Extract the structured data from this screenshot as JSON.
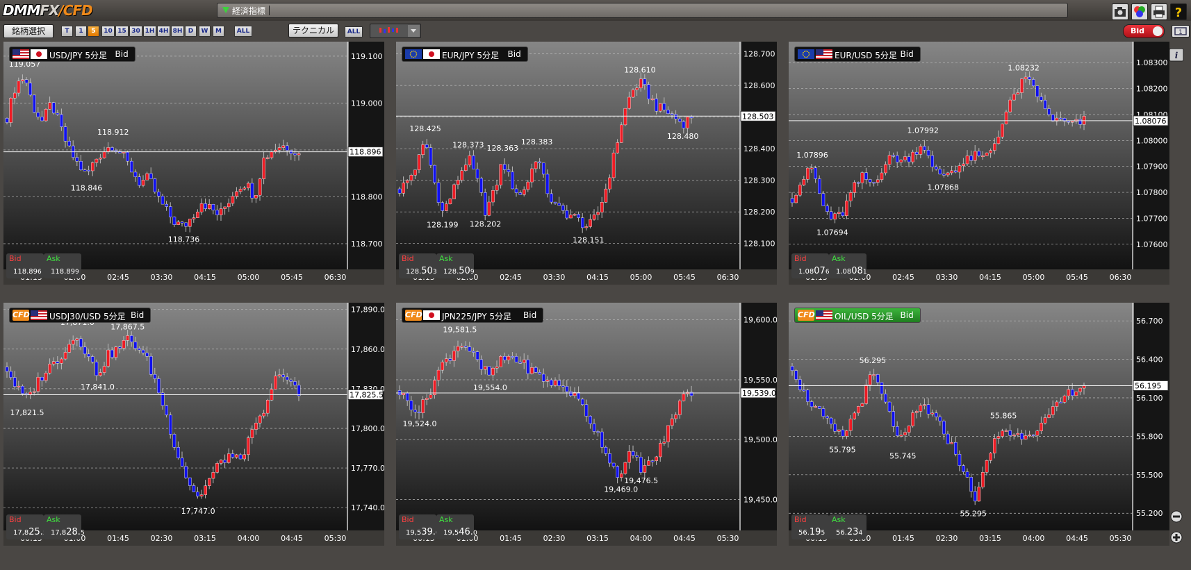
{
  "app": {
    "logo_dmm": "DMM",
    "logo_fx": "FX",
    "logo_slash": "/",
    "logo_cfd": "CFD"
  },
  "news": {
    "label": "経済指標"
  },
  "toolbar": {
    "symbol_select": "銘柄選択",
    "timeframes": [
      "T",
      "1",
      "5",
      "10",
      "15",
      "30",
      "1H",
      "4H",
      "8H",
      "D",
      "W",
      "M"
    ],
    "active_timeframe": "5",
    "tf_all": "ALL",
    "technical": "テクニカル",
    "tech_all": "ALL",
    "bid_toggle": "Bid"
  },
  "colors": {
    "up": "#ee1c25",
    "down": "#1010ee",
    "doji": "#d8d000",
    "accent": "#f08a1a"
  },
  "panels": [
    {
      "title": "USD/JPY 5分足",
      "mode": "Bid",
      "flags": [
        "us",
        "jp"
      ],
      "cfd": false,
      "current": "118.896",
      "current_value": 118.896,
      "bid": {
        "label": "Bid",
        "small": "118.89",
        "big": "",
        "tail": "6"
      },
      "ask": {
        "label": "Ask",
        "small": "118.89",
        "big": "",
        "tail": "9"
      },
      "ymin": 118.66,
      "ymax": 119.125,
      "ticks": [
        119.1,
        119.0,
        118.9,
        118.8,
        118.7
      ],
      "tick_labels": [
        "119.100",
        "119.000",
        "118.900",
        "118.800",
        "118.700"
      ],
      "xlabels": [
        "01:15",
        "02:00",
        "02:45",
        "03:30",
        "04:15",
        "05:00",
        "05:45",
        "06:30"
      ],
      "path": [
        118.97,
        119.04,
        119.057,
        118.99,
        118.96,
        119.0,
        118.95,
        118.9,
        118.87,
        118.846,
        118.88,
        118.9,
        118.912,
        118.89,
        118.86,
        118.83,
        118.84,
        118.8,
        118.77,
        118.745,
        118.736,
        118.76,
        118.79,
        118.775,
        118.76,
        118.79,
        118.82,
        118.83,
        118.8,
        118.88,
        118.9,
        118.91,
        118.905,
        118.89
      ],
      "annotations": [
        {
          "i": 2,
          "v": 119.057,
          "text": "119.057",
          "pos": "above"
        },
        {
          "i": 9,
          "v": 118.846,
          "text": "118.846",
          "pos": "below"
        },
        {
          "i": 12,
          "v": 118.912,
          "text": "118.912",
          "pos": "above"
        },
        {
          "i": 20,
          "v": 118.736,
          "text": "118.736",
          "pos": "below"
        }
      ]
    },
    {
      "title": "EUR/JPY 5分足",
      "mode": "Bid",
      "flags": [
        "eu",
        "jp"
      ],
      "cfd": false,
      "current": "128.503",
      "current_value": 128.503,
      "bid": {
        "label": "Bid",
        "small": "128.",
        "big": "50",
        "tail": "3"
      },
      "ask": {
        "label": "Ask",
        "small": "128.",
        "big": "50",
        "tail": "9"
      },
      "ymin": 128.04,
      "ymax": 128.73,
      "ticks": [
        128.7,
        128.6,
        128.5,
        128.4,
        128.3,
        128.2,
        128.1
      ],
      "tick_labels": [
        "128.700",
        "128.600",
        "128.500",
        "128.400",
        "128.300",
        "128.200",
        "128.100"
      ],
      "xlabels": [
        "01:15",
        "02:00",
        "02:45",
        "03:30",
        "04:15",
        "05:00",
        "05:45",
        "06:30"
      ],
      "path": [
        128.27,
        128.3,
        128.35,
        128.425,
        128.3,
        128.199,
        128.25,
        128.32,
        128.373,
        128.3,
        128.202,
        128.26,
        128.363,
        128.29,
        128.25,
        128.3,
        128.383,
        128.28,
        128.22,
        128.2,
        128.19,
        128.17,
        128.151,
        128.19,
        128.27,
        128.38,
        128.5,
        128.58,
        128.61,
        128.57,
        128.53,
        128.52,
        128.5,
        128.48,
        128.503
      ],
      "annotations": [
        {
          "i": 3,
          "v": 128.425,
          "text": "128.425",
          "pos": "above"
        },
        {
          "i": 5,
          "v": 128.199,
          "text": "128.199",
          "pos": "below"
        },
        {
          "i": 8,
          "v": 128.373,
          "text": "128.373",
          "pos": "above"
        },
        {
          "i": 10,
          "v": 128.202,
          "text": "128.202",
          "pos": "below"
        },
        {
          "i": 12,
          "v": 128.363,
          "text": "128.363",
          "pos": "above"
        },
        {
          "i": 16,
          "v": 128.383,
          "text": "128.383",
          "pos": "above"
        },
        {
          "i": 22,
          "v": 128.151,
          "text": "128.151",
          "pos": "below"
        },
        {
          "i": 28,
          "v": 128.61,
          "text": "128.610",
          "pos": "above"
        },
        {
          "i": 33,
          "v": 128.48,
          "text": "128.480",
          "pos": "below"
        }
      ]
    },
    {
      "title": "EUR/USD 5分足",
      "mode": "Bid",
      "flags": [
        "eu",
        "us"
      ],
      "cfd": false,
      "current": "1.08076",
      "current_value": 1.08076,
      "bid": {
        "label": "Bid",
        "small": "1.08",
        "big": "07",
        "tail": "6"
      },
      "ask": {
        "label": "Ask",
        "small": "1.08",
        "big": "08",
        "tail": "1"
      },
      "ymin": 1.0753,
      "ymax": 1.0837,
      "ticks": [
        1.083,
        1.082,
        1.081,
        1.08,
        1.079,
        1.078,
        1.077,
        1.076
      ],
      "tick_labels": [
        "1.08300",
        "1.08200",
        "1.08100",
        "1.08000",
        "1.07900",
        "1.07800",
        "1.07700",
        "1.07600"
      ],
      "xlabels": [
        "01:15",
        "02:00",
        "02:45",
        "03:30",
        "04:15",
        "05:00",
        "05:45",
        "06:30"
      ],
      "path": [
        1.0778,
        1.0785,
        1.07896,
        1.0775,
        1.07694,
        1.0772,
        1.0781,
        1.0786,
        1.0783,
        1.079,
        1.0794,
        1.0792,
        1.0795,
        1.07992,
        1.0788,
        1.07868,
        1.0789,
        1.0791,
        1.0794,
        1.0793,
        1.0798,
        1.0808,
        1.0817,
        1.08232,
        1.0821,
        1.0812,
        1.0808,
        1.0807,
        1.0806,
        1.08076
      ],
      "annotations": [
        {
          "i": 2,
          "v": 1.07896,
          "text": "1.07896",
          "pos": "above"
        },
        {
          "i": 4,
          "v": 1.07694,
          "text": "1.07694",
          "pos": "below"
        },
        {
          "i": 13,
          "v": 1.07992,
          "text": "1.07992",
          "pos": "above"
        },
        {
          "i": 15,
          "v": 1.07868,
          "text": "1.07868",
          "pos": "below"
        },
        {
          "i": 23,
          "v": 1.08232,
          "text": "1.08232",
          "pos": "above"
        }
      ]
    },
    {
      "title": "USDJ30/USD 5分足",
      "mode": "Bid",
      "flags": [
        "us"
      ],
      "cfd": true,
      "current": "17,825.5",
      "current_value": 17825.5,
      "bid": {
        "label": "Bid",
        "small": "17,8",
        "big": "25.",
        "tail": "5"
      },
      "ask": {
        "label": "Ask",
        "small": "17,8",
        "big": "28.",
        "tail": "5"
      },
      "ymin": 17728,
      "ymax": 17893,
      "ticks": [
        17890,
        17860,
        17830,
        17800,
        17770,
        17740
      ],
      "tick_labels": [
        "17,890.0",
        "17,860.0",
        "17,830.0",
        "17,800.0",
        "17,770.0",
        "17,740.0"
      ],
      "xlabels": [
        "00:15",
        "01:00",
        "01:45",
        "02:30",
        "03:15",
        "04:00",
        "04:45",
        "05:30"
      ],
      "path": [
        17845,
        17830,
        17821.5,
        17835,
        17845,
        17852,
        17862,
        17871,
        17855,
        17841,
        17855,
        17860,
        17867.5,
        17862,
        17850,
        17830,
        17805,
        17780,
        17760,
        17747,
        17760,
        17772,
        17780,
        17775,
        17790,
        17805,
        17820,
        17845,
        17835,
        17825.5
      ],
      "annotations": [
        {
          "i": 2,
          "v": 17821.5,
          "text": "17,821.5",
          "pos": "below"
        },
        {
          "i": 7,
          "v": 17871,
          "text": "17,871.0",
          "pos": "above"
        },
        {
          "i": 9,
          "v": 17841,
          "text": "17,841.0",
          "pos": "below"
        },
        {
          "i": 12,
          "v": 17867.5,
          "text": "17,867.5",
          "pos": "above"
        },
        {
          "i": 19,
          "v": 17747,
          "text": "17,747.0",
          "pos": "below"
        }
      ]
    },
    {
      "title": "JPN225/JPY 5分足",
      "mode": "Bid",
      "flags": [
        "jp"
      ],
      "cfd": true,
      "current": "19,539.0",
      "current_value": 19539,
      "bid": {
        "label": "Bid",
        "small": "19,5",
        "big": "39.",
        "tail": "0"
      },
      "ask": {
        "label": "Ask",
        "small": "19,5",
        "big": "46.",
        "tail": "0"
      },
      "ymin": 19430,
      "ymax": 19612,
      "ticks": [
        19600,
        19550,
        19500,
        19450
      ],
      "tick_labels": [
        "19,600.0",
        "19,550.0",
        "19,500.0",
        "19,450.0"
      ],
      "xlabels": [
        "00:15",
        "01:00",
        "01:45",
        "02:30",
        "03:15",
        "04:00",
        "04:45",
        "05:30"
      ],
      "path": [
        19540,
        19530,
        19524,
        19540,
        19560,
        19570,
        19581.5,
        19575,
        19560,
        19554,
        19565,
        19570,
        19565,
        19558,
        19552,
        19548,
        19545,
        19540,
        19530,
        19515,
        19500,
        19480,
        19469,
        19490,
        19476.5,
        19480,
        19495,
        19515,
        19535,
        19539
      ],
      "annotations": [
        {
          "i": 2,
          "v": 19524,
          "text": "19,524.0",
          "pos": "below"
        },
        {
          "i": 6,
          "v": 19581.5,
          "text": "19,581.5",
          "pos": "above"
        },
        {
          "i": 9,
          "v": 19554,
          "text": "19,554.0",
          "pos": "below"
        },
        {
          "i": 22,
          "v": 19469,
          "text": "19,469.0",
          "pos": "below"
        },
        {
          "i": 24,
          "v": 19476.5,
          "text": "19,476.5",
          "pos": "below"
        }
      ]
    },
    {
      "title": "OIL/USD 5分足",
      "mode": "Bid",
      "flags": [
        "us"
      ],
      "cfd": true,
      "highlight": true,
      "current": "56.195",
      "current_value": 56.195,
      "bid": {
        "label": "Bid",
        "small": "56.",
        "big": "19",
        "tail": "5"
      },
      "ask": {
        "label": "Ask",
        "small": "56.",
        "big": "23",
        "tail": "4"
      },
      "ymin": 55.12,
      "ymax": 56.82,
      "ticks": [
        56.7,
        56.4,
        56.1,
        55.8,
        55.5,
        55.2
      ],
      "tick_labels": [
        "56.700",
        "56.400",
        "56.100",
        "55.800",
        "55.500",
        "55.200"
      ],
      "xlabels": [
        "00:15",
        "01:00",
        "01:45",
        "02:30",
        "03:15",
        "04:00",
        "04:45",
        "05:30"
      ],
      "path": [
        56.35,
        56.15,
        56.05,
        55.95,
        55.85,
        55.795,
        55.95,
        56.1,
        56.295,
        56.1,
        55.9,
        55.745,
        55.95,
        56.05,
        55.95,
        55.85,
        55.7,
        55.55,
        55.295,
        55.5,
        55.75,
        55.865,
        55.8,
        55.82,
        55.85,
        55.9,
        56.0,
        56.1,
        56.17,
        56.195
      ],
      "annotations": [
        {
          "i": 5,
          "v": 55.795,
          "text": "55.795",
          "pos": "below"
        },
        {
          "i": 8,
          "v": 56.295,
          "text": "56.295",
          "pos": "above"
        },
        {
          "i": 11,
          "v": 55.745,
          "text": "55.745",
          "pos": "below"
        },
        {
          "i": 18,
          "v": 55.295,
          "text": "55.295",
          "pos": "below"
        },
        {
          "i": 21,
          "v": 55.865,
          "text": "55.865",
          "pos": "above"
        }
      ]
    }
  ]
}
